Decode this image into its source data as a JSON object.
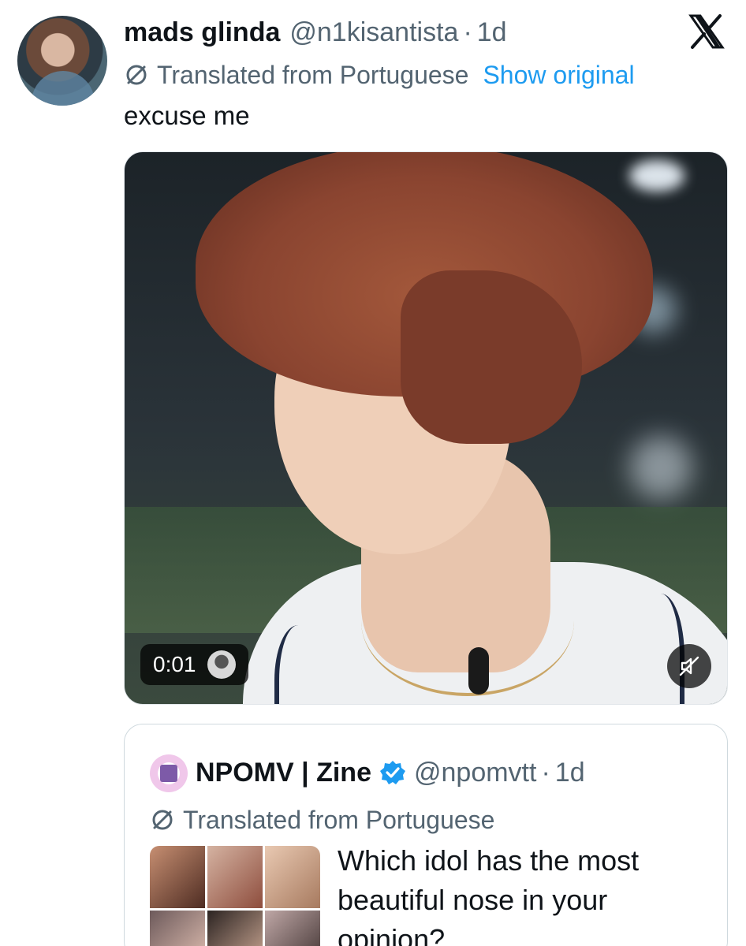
{
  "tweet": {
    "display_name": "mads glinda",
    "handle": "@n1kisantista",
    "separator": "·",
    "time": "1d",
    "translation_note": "Translated from Portuguese",
    "show_original_label": "Show original",
    "text": "excuse me",
    "avatar_icon": "profile-photo",
    "close_icon": "x-logo-icon",
    "media": {
      "duration": "0:01",
      "mute_icon": "muted-speaker-icon",
      "source_avatar_icon": "source-avatar"
    }
  },
  "quoted_tweet": {
    "display_name": "NPOMV | Zine",
    "verified_icon": "verified-badge-icon",
    "handle": "@npomvtt",
    "separator": "·",
    "time": "1d",
    "translation_note": "Translated from Portuguese",
    "text": "Which idol has the most beautiful nose in your opinion?"
  },
  "colors": {
    "text_primary": "#0f1419",
    "text_secondary": "#536471",
    "link": "#1d9bf0",
    "verified": "#1d9bf0",
    "border": "#cfd9de"
  }
}
